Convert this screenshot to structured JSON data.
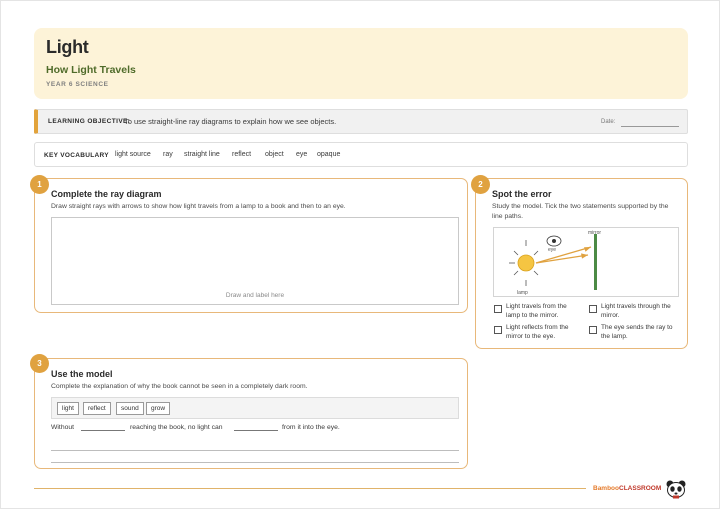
{
  "header": {
    "title": "Light",
    "subtitle": "How Light Travels",
    "year": "YEAR 6 SCIENCE"
  },
  "objective": {
    "label": "LEARNING OBJECTIVE:",
    "text": "To use straight-line ray diagrams to explain how we see objects.",
    "date_label": "Date:"
  },
  "vocabulary": {
    "label": "KEY VOCABULARY",
    "words": [
      "light source",
      "ray",
      "straight line",
      "reflect",
      "object",
      "eye",
      "opaque"
    ]
  },
  "task1": {
    "number": "1",
    "title": "Complete the ray diagram",
    "instruction": "Draw straight rays with arrows to show how light travels from a lamp to a book and then to an eye.",
    "hint": "Draw and label here"
  },
  "task2": {
    "number": "2",
    "title": "Spot the error",
    "instruction": "Study the model. Tick the two statements supported by the line paths.",
    "diagram_labels": {
      "mirror": "mirror",
      "eye": "eye",
      "lamp": "lamp"
    },
    "statements": [
      "Light travels from the lamp to the mirror.",
      "Light travels through the mirror.",
      "Light reflects from the mirror to the eye.",
      "The eye sends the ray to the lamp."
    ]
  },
  "task3": {
    "number": "3",
    "title": "Use the model",
    "instruction": "Complete the explanation of why the book cannot be seen in a completely dark room.",
    "word_bank": [
      "light",
      "reflect",
      "sound",
      "grow"
    ],
    "sentence_parts": [
      "Without",
      "reaching the book, no light can",
      "from it into the eye."
    ]
  },
  "footer": {
    "brand_part1": "Bamboo",
    "brand_part2": "CLASSROOM"
  },
  "colors": {
    "accent": "#e0a240",
    "header_bg": "#fdf3d8",
    "subtitle": "#4f6b2a",
    "mirror": "#4c8a45",
    "sun": "#f5c542"
  },
  "icons": [
    "sun-icon",
    "eye-icon",
    "panda-icon"
  ]
}
